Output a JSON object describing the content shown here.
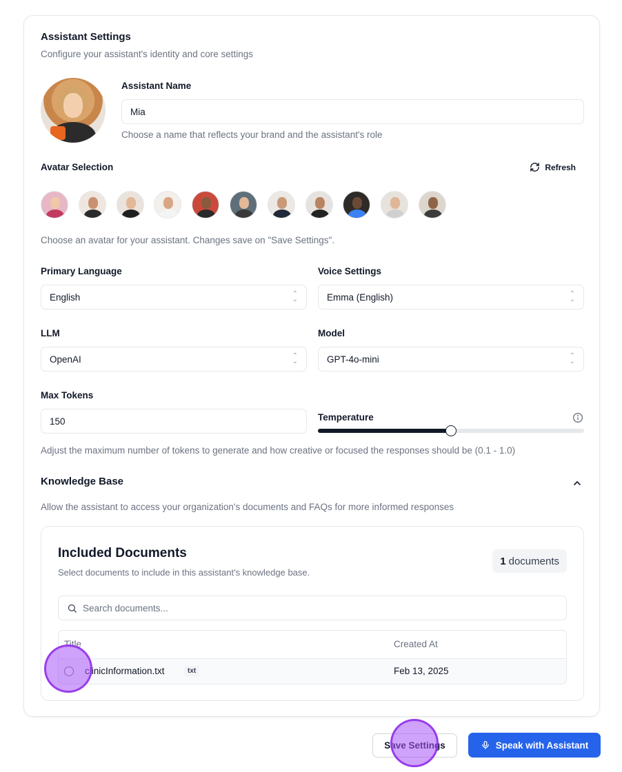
{
  "header": {
    "title": "Assistant Settings",
    "subtitle": "Configure your assistant's identity and core settings"
  },
  "assistant_name": {
    "label": "Assistant Name",
    "value": "Mia",
    "help": "Choose a name that reflects your brand and the assistant's role"
  },
  "avatar_selection": {
    "label": "Avatar Selection",
    "refresh_label": "Refresh",
    "help": "Choose an avatar for your assistant. Changes save on \"Save Settings\".",
    "avatars": [
      {
        "bg": "#e7b7c6",
        "face": "#f1c7a8",
        "body": "#c23b5f"
      },
      {
        "bg": "#efe7df",
        "face": "#c89270",
        "body": "#2b2b2b"
      },
      {
        "bg": "#e9e3dc",
        "face": "#e2b896",
        "body": "#1f1f1f"
      },
      {
        "bg": "#f3efea",
        "face": "#d8a585",
        "body": "#f4f4f4"
      },
      {
        "bg": "#c94a3c",
        "face": "#8a5a3c",
        "body": "#2a2a2a"
      },
      {
        "bg": "#5f6f7a",
        "face": "#e2b898",
        "body": "#3a3a3a"
      },
      {
        "bg": "#ece8e3",
        "face": "#c99a78",
        "body": "#1f2937"
      },
      {
        "bg": "#e6e3df",
        "face": "#b98461",
        "body": "#222"
      },
      {
        "bg": "#2d2a28",
        "face": "#6b4a35",
        "body": "#3b82f6"
      },
      {
        "bg": "#e7e2dc",
        "face": "#e0b697",
        "body": "#cfcfcf"
      },
      {
        "bg": "#ddd6ce",
        "face": "#8f6547",
        "body": "#3c3c3c"
      }
    ]
  },
  "primary_language": {
    "label": "Primary Language",
    "value": "English"
  },
  "voice_settings": {
    "label": "Voice Settings",
    "value": "Emma (English)"
  },
  "llm": {
    "label": "LLM",
    "value": "OpenAI"
  },
  "model": {
    "label": "Model",
    "value": "GPT-4o-mini"
  },
  "max_tokens": {
    "label": "Max Tokens",
    "value": "150"
  },
  "temperature": {
    "label": "Temperature",
    "value_fraction": 0.5
  },
  "tokens_help": "Adjust the maximum number of tokens to generate and how creative or focused the responses should be (0.1 - 1.0)",
  "knowledge_base": {
    "title": "Knowledge Base",
    "description": "Allow the assistant to access your organization's documents and FAQs for more informed responses"
  },
  "documents": {
    "title": "Included Documents",
    "subtitle": "Select documents to include in this assistant's knowledge base.",
    "count": "1",
    "count_suffix": "documents",
    "search_placeholder": "Search documents...",
    "columns": {
      "title": "Title",
      "created_at": "Created At"
    },
    "rows": [
      {
        "name": "clinicInformation.txt",
        "ext": "txt",
        "created_at": "Feb 13, 2025"
      }
    ]
  },
  "footer": {
    "save_label": "Save Settings",
    "speak_label": "Speak with Assistant"
  },
  "colors": {
    "primary": "#2563eb",
    "click_marker": "#a855f7"
  }
}
